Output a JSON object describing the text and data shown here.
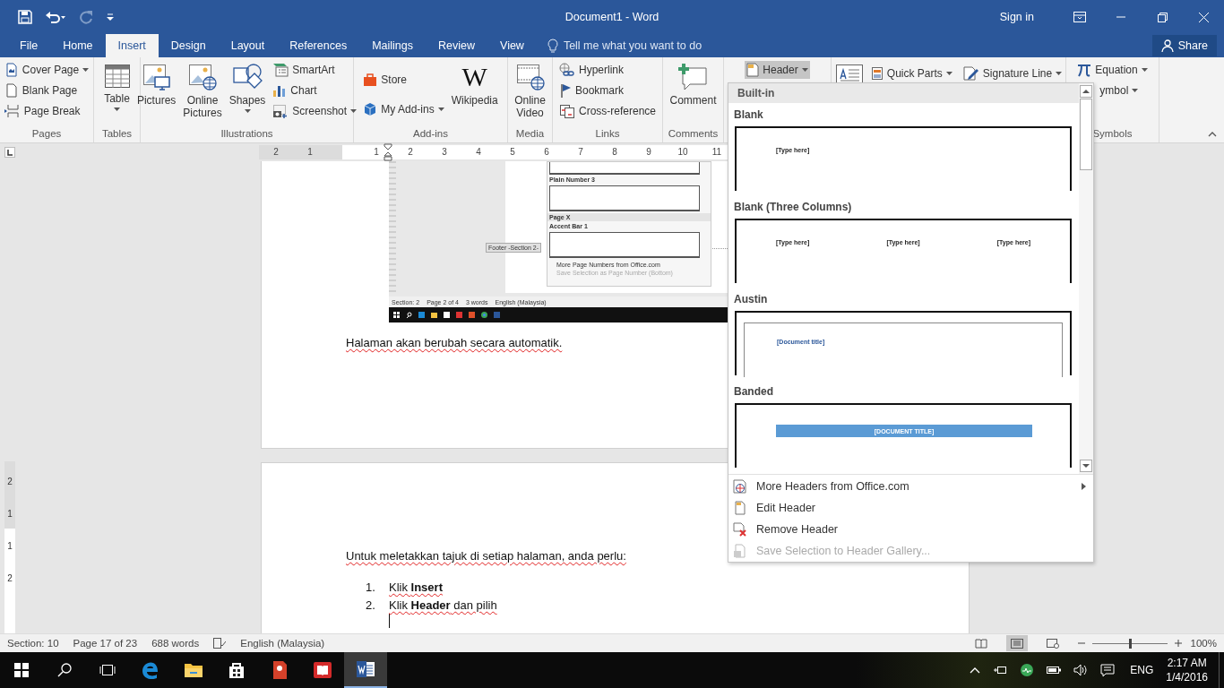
{
  "title_bar": {
    "quick_access": [
      {
        "disabled": false
      },
      {
        "disabled": false
      },
      {
        "disabled": true
      },
      {
        "disabled": false
      }
    ],
    "title": "Document1 - Word",
    "sign_in": "Sign in"
  },
  "tabs": [
    {
      "label": "File",
      "selected": false
    },
    {
      "label": "Home",
      "selected": false
    },
    {
      "label": "Insert",
      "selected": true
    },
    {
      "label": "Design",
      "selected": false
    },
    {
      "label": "Layout",
      "selected": false
    },
    {
      "label": "References",
      "selected": false
    },
    {
      "label": "Mailings",
      "selected": false
    },
    {
      "label": "Review",
      "selected": false
    },
    {
      "label": "View",
      "selected": false
    }
  ],
  "tell_me": "Tell me what you want to do",
  "share": "Share",
  "ribbon": [
    {
      "label": "Pages",
      "items": [
        {
          "kind": "small",
          "label": "Cover Page",
          "dropdown": true
        },
        {
          "kind": "small",
          "label": "Blank Page",
          "dropdown": false
        },
        {
          "kind": "small",
          "label": "Page Break",
          "dropdown": false
        }
      ]
    },
    {
      "label": "Tables",
      "items": [
        {
          "kind": "large",
          "label": "Table",
          "dropdown": true
        }
      ]
    },
    {
      "label": "Illustrations",
      "items": [
        {
          "kind": "large",
          "label": "Pictures",
          "dropdown": false
        },
        {
          "kind": "large",
          "label": "Online Pictures",
          "dropdown": false
        },
        {
          "kind": "large",
          "label": "Shapes",
          "dropdown": true
        },
        {
          "kind": "small",
          "label": "SmartArt",
          "dropdown": false
        },
        {
          "kind": "small",
          "label": "Chart",
          "dropdown": false
        },
        {
          "kind": "small",
          "label": "Screenshot",
          "dropdown": true
        }
      ]
    },
    {
      "label": "Add-ins",
      "items": [
        {
          "kind": "small",
          "label": "Store",
          "dropdown": false
        },
        {
          "kind": "small",
          "label": "My Add-ins",
          "dropdown": true
        },
        {
          "kind": "large",
          "label": "Wikipedia",
          "dropdown": false,
          "glyph": "W"
        }
      ]
    },
    {
      "label": "Media",
      "items": [
        {
          "kind": "large",
          "label": "Online Video",
          "dropdown": false
        }
      ]
    },
    {
      "label": "Links",
      "items": [
        {
          "kind": "small",
          "label": "Hyperlink",
          "dropdown": false
        },
        {
          "kind": "small",
          "label": "Bookmark",
          "dropdown": false
        },
        {
          "kind": "small",
          "label": "Cross-reference",
          "dropdown": false
        }
      ]
    },
    {
      "label": "Comments",
      "items": [
        {
          "kind": "large",
          "label": "Comment",
          "dropdown": false
        }
      ]
    },
    {
      "items": [
        {
          "kind": "small",
          "label": "Header",
          "dropdown": true,
          "pressed": true
        }
      ]
    },
    {
      "items": [
        {
          "kind": "large"
        },
        {
          "kind": "inline",
          "label": "Quick Parts",
          "dropdown": true
        },
        {
          "kind": "inline",
          "label": "Signature Line",
          "dropdown": true
        }
      ]
    },
    {
      "label": "Symbols",
      "items": [
        {
          "kind": "small",
          "label": "Equation",
          "dropdown": true
        },
        {
          "kind": "small",
          "label": "ymbol",
          "dropdown": true
        }
      ]
    }
  ],
  "ruler": {
    "left_labels": [
      "2",
      "1"
    ],
    "right_labels": [
      "1",
      "2",
      "3",
      "4",
      "5",
      "6",
      "7",
      "8",
      "9",
      "10",
      "11"
    ],
    "vertical_labels": [
      "2",
      "1",
      "1",
      "2"
    ]
  },
  "pages": [
    {
      "blocks": [
        {
          "kind": "screenshot",
          "gallery": [
            {
              "kind": "preview"
            },
            {
              "kind": "label",
              "text": "Plain Number 3"
            },
            {
              "kind": "preview"
            },
            {
              "kind": "heading",
              "text": "Page X"
            },
            {
              "kind": "label",
              "text": "Accent Bar 1"
            },
            {
              "kind": "preview"
            }
          ],
          "commands": [
            {
              "label": "More Page Numbers from Office.com",
              "disabled": false
            },
            {
              "label": "Save Selection as Page Number (Bottom)",
              "disabled": true
            }
          ],
          "footer_tag": "Footer -Section 2-",
          "status": [
            "Section: 2",
            "Page 2 of 4",
            "3 words",
            "English (Malaysia)"
          ]
        },
        {
          "kind": "paragraph",
          "text": "Halaman akan berubah secara automatik.",
          "spelling_marked": true
        }
      ]
    },
    {
      "blocks": [
        {
          "kind": "paragraph",
          "text": "Untuk meletakkan tajuk di setiap halaman, anda perlu:",
          "spelling_marked": true
        },
        {
          "kind": "list",
          "items": [
            {
              "number": "1.",
              "text": "Klik **Insert**"
            },
            {
              "number": "2.",
              "text": "Klik **Header** dan pilih"
            }
          ],
          "cursor": true
        }
      ]
    }
  ],
  "header_menu": {
    "gallery_heading": "Built-in",
    "entries": [
      {
        "name": "Blank",
        "kind": "blank",
        "placeholders": [
          "[Type here]"
        ]
      },
      {
        "name": "Blank (Three Columns)",
        "kind": "three_columns",
        "placeholders": [
          "[Type here]",
          "[Type here]",
          "[Type here]"
        ]
      },
      {
        "name": "Austin",
        "kind": "austin",
        "placeholders": [
          "[Document title]"
        ]
      },
      {
        "name": "Banded",
        "kind": "banded",
        "placeholders": [
          "[DOCUMENT TITLE]"
        ]
      }
    ],
    "commands": [
      {
        "label": "More Headers from Office.com",
        "disabled": false,
        "submenu": true
      },
      {
        "label": "Edit Header",
        "disabled": false,
        "submenu": false
      },
      {
        "label": "Remove Header",
        "disabled": false,
        "submenu": false
      },
      {
        "label": "Save Selection to Header Gallery...",
        "disabled": true,
        "submenu": false
      }
    ]
  },
  "status_bar": {
    "section": "Section: 10",
    "page": "Page 17 of 23",
    "words": "688 words",
    "language": "English (Malaysia)",
    "views": [
      {
        "selected": false
      },
      {
        "selected": true
      },
      {
        "selected": false
      }
    ],
    "zoom": {
      "level": 0.5,
      "reading": "100%"
    }
  },
  "taskbar": {
    "apps": [
      {
        "active": false
      },
      {
        "active": false
      },
      {
        "active": false
      },
      {
        "active": false
      },
      {
        "active": false
      },
      {
        "active": true
      }
    ],
    "language": "ENG",
    "time": "2:17 AM",
    "date": "1/4/2016"
  }
}
